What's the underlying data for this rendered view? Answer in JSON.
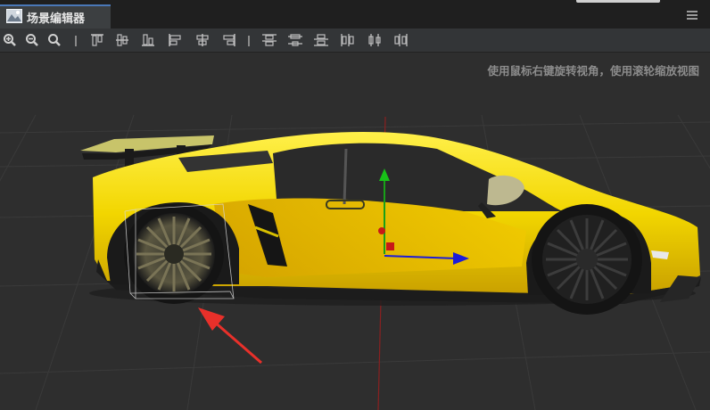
{
  "tab": {
    "title": "场景编辑器"
  },
  "viewport": {
    "hint": "使用鼠标右键旋转视角，使用滚轮缩放视图"
  },
  "colors": {
    "accent": "#4a78b8",
    "car_body": "#f2d600",
    "axis_x": "#1c1cd8",
    "axis_y": "#18a018",
    "axis_z": "#c81818",
    "arrow": "#e8302a"
  },
  "toolbar": {
    "icons": [
      "zoom-in-icon",
      "zoom-out-icon",
      "zoom-reset-icon",
      "align-top-icon",
      "align-vcenter-icon",
      "align-bottom-icon",
      "align-left-icon",
      "align-hcenter-icon",
      "align-right-icon",
      "distribute-top-icon",
      "distribute-vcenter-icon",
      "distribute-bottom-icon",
      "distribute-left-icon",
      "distribute-hcenter-icon",
      "distribute-right-icon"
    ]
  }
}
